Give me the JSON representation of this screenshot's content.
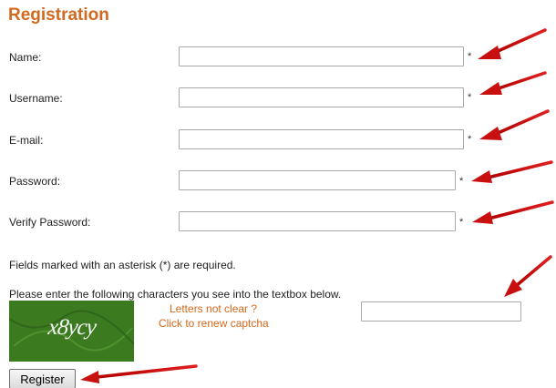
{
  "form": {
    "title": "Registration",
    "fields": {
      "name": {
        "label": "Name:",
        "value": "",
        "required_mark": "*"
      },
      "username": {
        "label": "Username:",
        "value": "",
        "required_mark": "*"
      },
      "email": {
        "label": "E-mail:",
        "value": "",
        "required_mark": "*"
      },
      "password": {
        "label": "Password:",
        "value": "",
        "required_mark": "*"
      },
      "verify_password": {
        "label": "Verify Password:",
        "value": "",
        "required_mark": "*"
      }
    },
    "required_note": "Fields marked with an asterisk (*) are required.",
    "captcha_instruction": "Please enter the following characters you see into the textbox below.",
    "captcha": {
      "image_text": "x8ycy",
      "renew_line1": "Letters not clear ?",
      "renew_line2": "Click to renew captcha",
      "input_value": ""
    },
    "submit_label": "Register"
  },
  "colors": {
    "accent": "#d2691e",
    "captcha_bg": "#3b7a1f",
    "annotation_arrow": "#cc1111"
  }
}
